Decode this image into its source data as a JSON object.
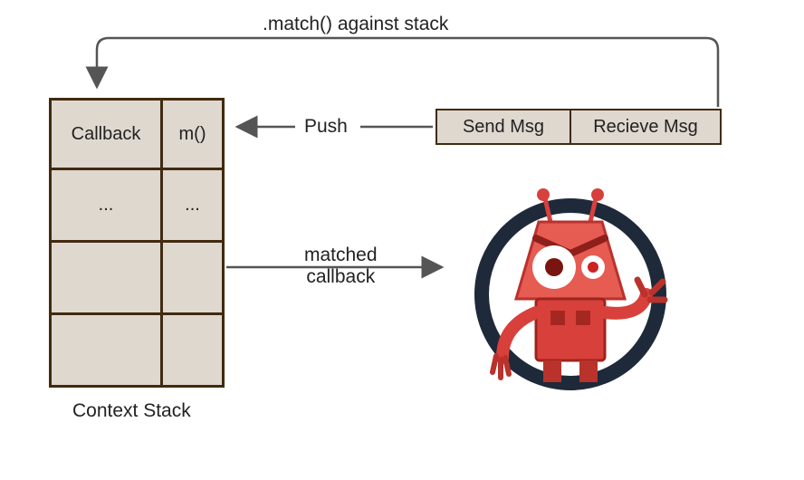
{
  "top_label": ".match() against stack",
  "push_label": "Push",
  "matched_label_line1": "matched",
  "matched_label_line2": "callback",
  "stack": {
    "caption": "Context Stack",
    "rows": [
      {
        "col1": "Callback",
        "col2": "m()"
      },
      {
        "col1": "...",
        "col2": "..."
      },
      {
        "col1": "",
        "col2": ""
      },
      {
        "col1": "",
        "col2": ""
      }
    ]
  },
  "msg": {
    "send": "Send Msg",
    "receive": "Recieve Msg"
  }
}
